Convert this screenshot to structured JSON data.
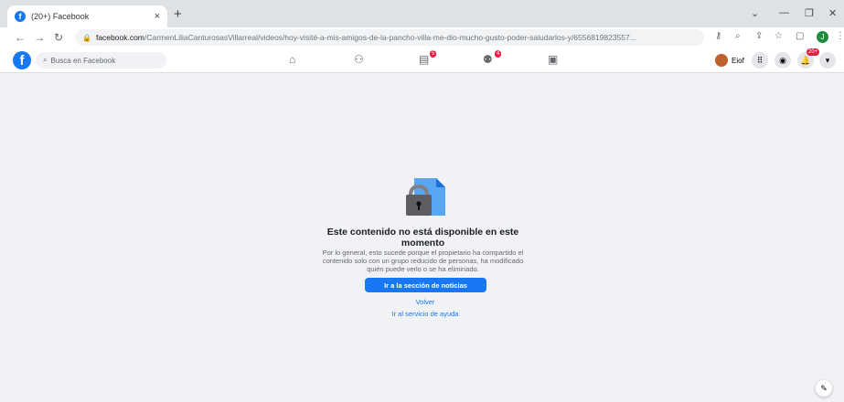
{
  "browser": {
    "tab_title": "(20+) Facebook",
    "tab_close": "×",
    "new_tab": "+",
    "url_host": "facebook.com",
    "url_path": "/CarmenLiliaCanturosasVillarreal/videos/hoy-visité-a-mis-amigos-de-la-pancho-villa-me-dio-mucho-gusto-poder-saludarlos-y/6556819823557...",
    "profile_initial": "J"
  },
  "facebook": {
    "search_placeholder": "Busca en Facebook",
    "marketplace_badge": "5",
    "groups_badge": "4",
    "user_name": "Eiof",
    "notifications_badge": "20+"
  },
  "page": {
    "heading": "Este contenido no está disponible en este momento",
    "description": "Por lo general, esto sucede porque el propietario ha compartido el contenido solo con un grupo reducido de personas, ha modificado quién puede verlo o se ha eliminado.",
    "primary_button": "Ir a la sección de noticias",
    "back_link": "Volver",
    "help_link": "Ir al servicio de ayuda"
  },
  "colors": {
    "brand": "#1877f2",
    "badge": "#e41e3f",
    "background": "#f0f2f5"
  }
}
